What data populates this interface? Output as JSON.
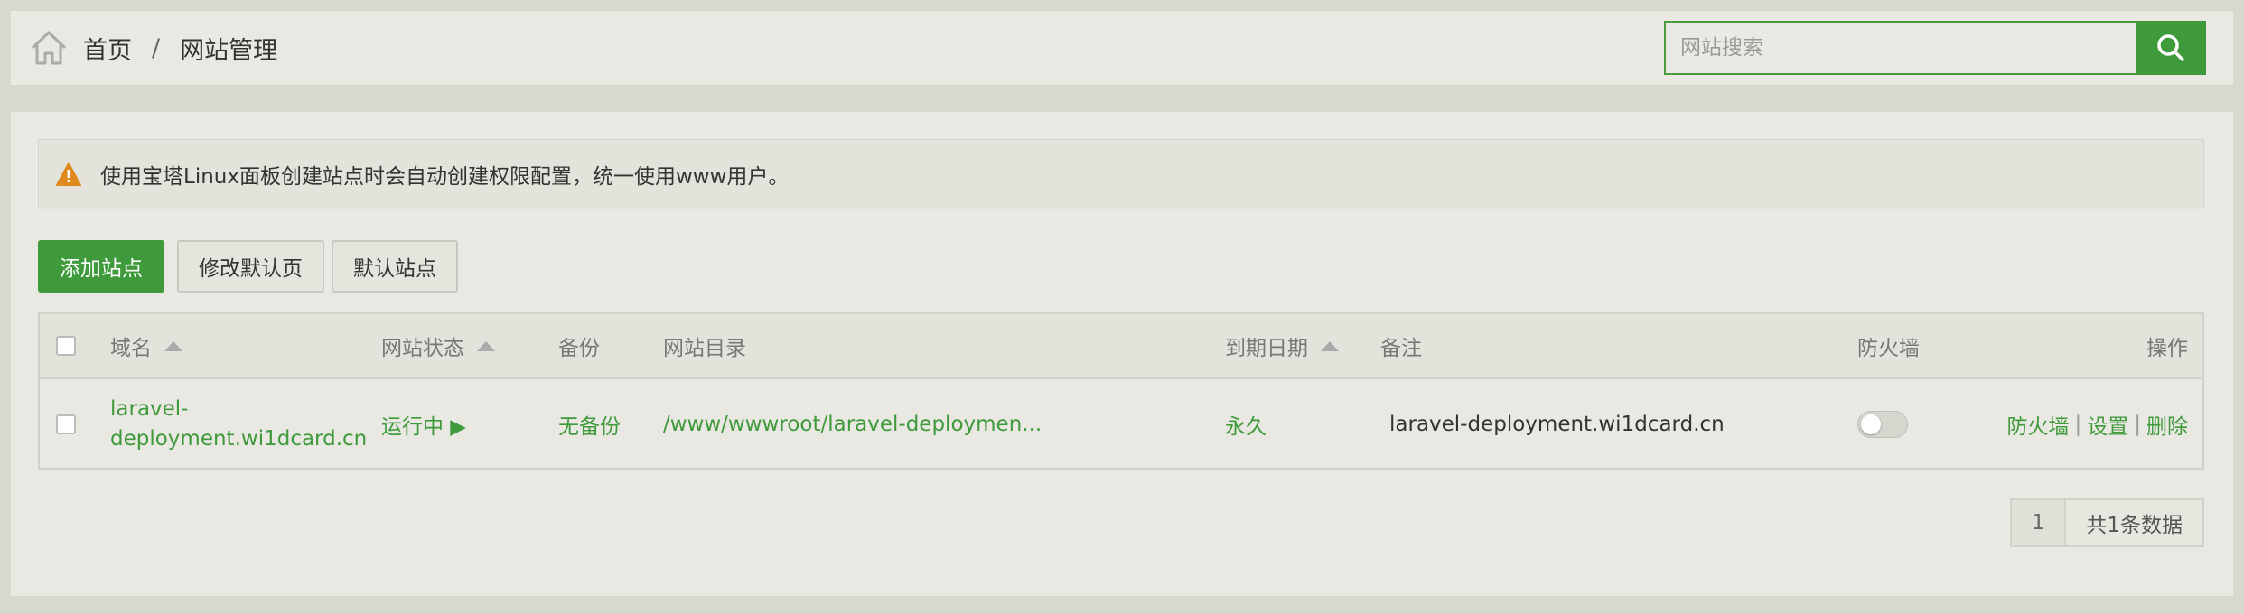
{
  "breadcrumb": {
    "home": "首页",
    "separator": "/",
    "current": "网站管理"
  },
  "search": {
    "placeholder": "网站搜索",
    "value": ""
  },
  "notice": "使用宝塔Linux面板创建站点时会自动创建权限配置，统一使用www用户。",
  "buttons": {
    "add_site": "添加站点",
    "edit_default_page": "修改默认页",
    "default_site": "默认站点"
  },
  "table": {
    "columns": {
      "domain": "域名",
      "status": "网站状态",
      "backup": "备份",
      "root": "网站目录",
      "expire": "到期日期",
      "note": "备注",
      "firewall": "防火墙",
      "actions": "操作"
    },
    "rows": [
      {
        "domain_line1": "laravel-",
        "domain_line2": "deployment.wi1dcard.cn",
        "status": "运行中 ▶",
        "backup": "无备份",
        "root": "/www/wwwroot/laravel-deploymen...",
        "expire": "永久",
        "note": "laravel-deployment.wi1dcard.cn",
        "firewall_on": false,
        "actions": {
          "firewall": "防火墙",
          "settings": "设置",
          "delete": "删除",
          "separator": "|"
        }
      }
    ]
  },
  "pagination": {
    "current": "1",
    "total": "共1条数据"
  },
  "colors": {
    "accent": "#3f9a3c",
    "warning": "#e08a1e"
  }
}
